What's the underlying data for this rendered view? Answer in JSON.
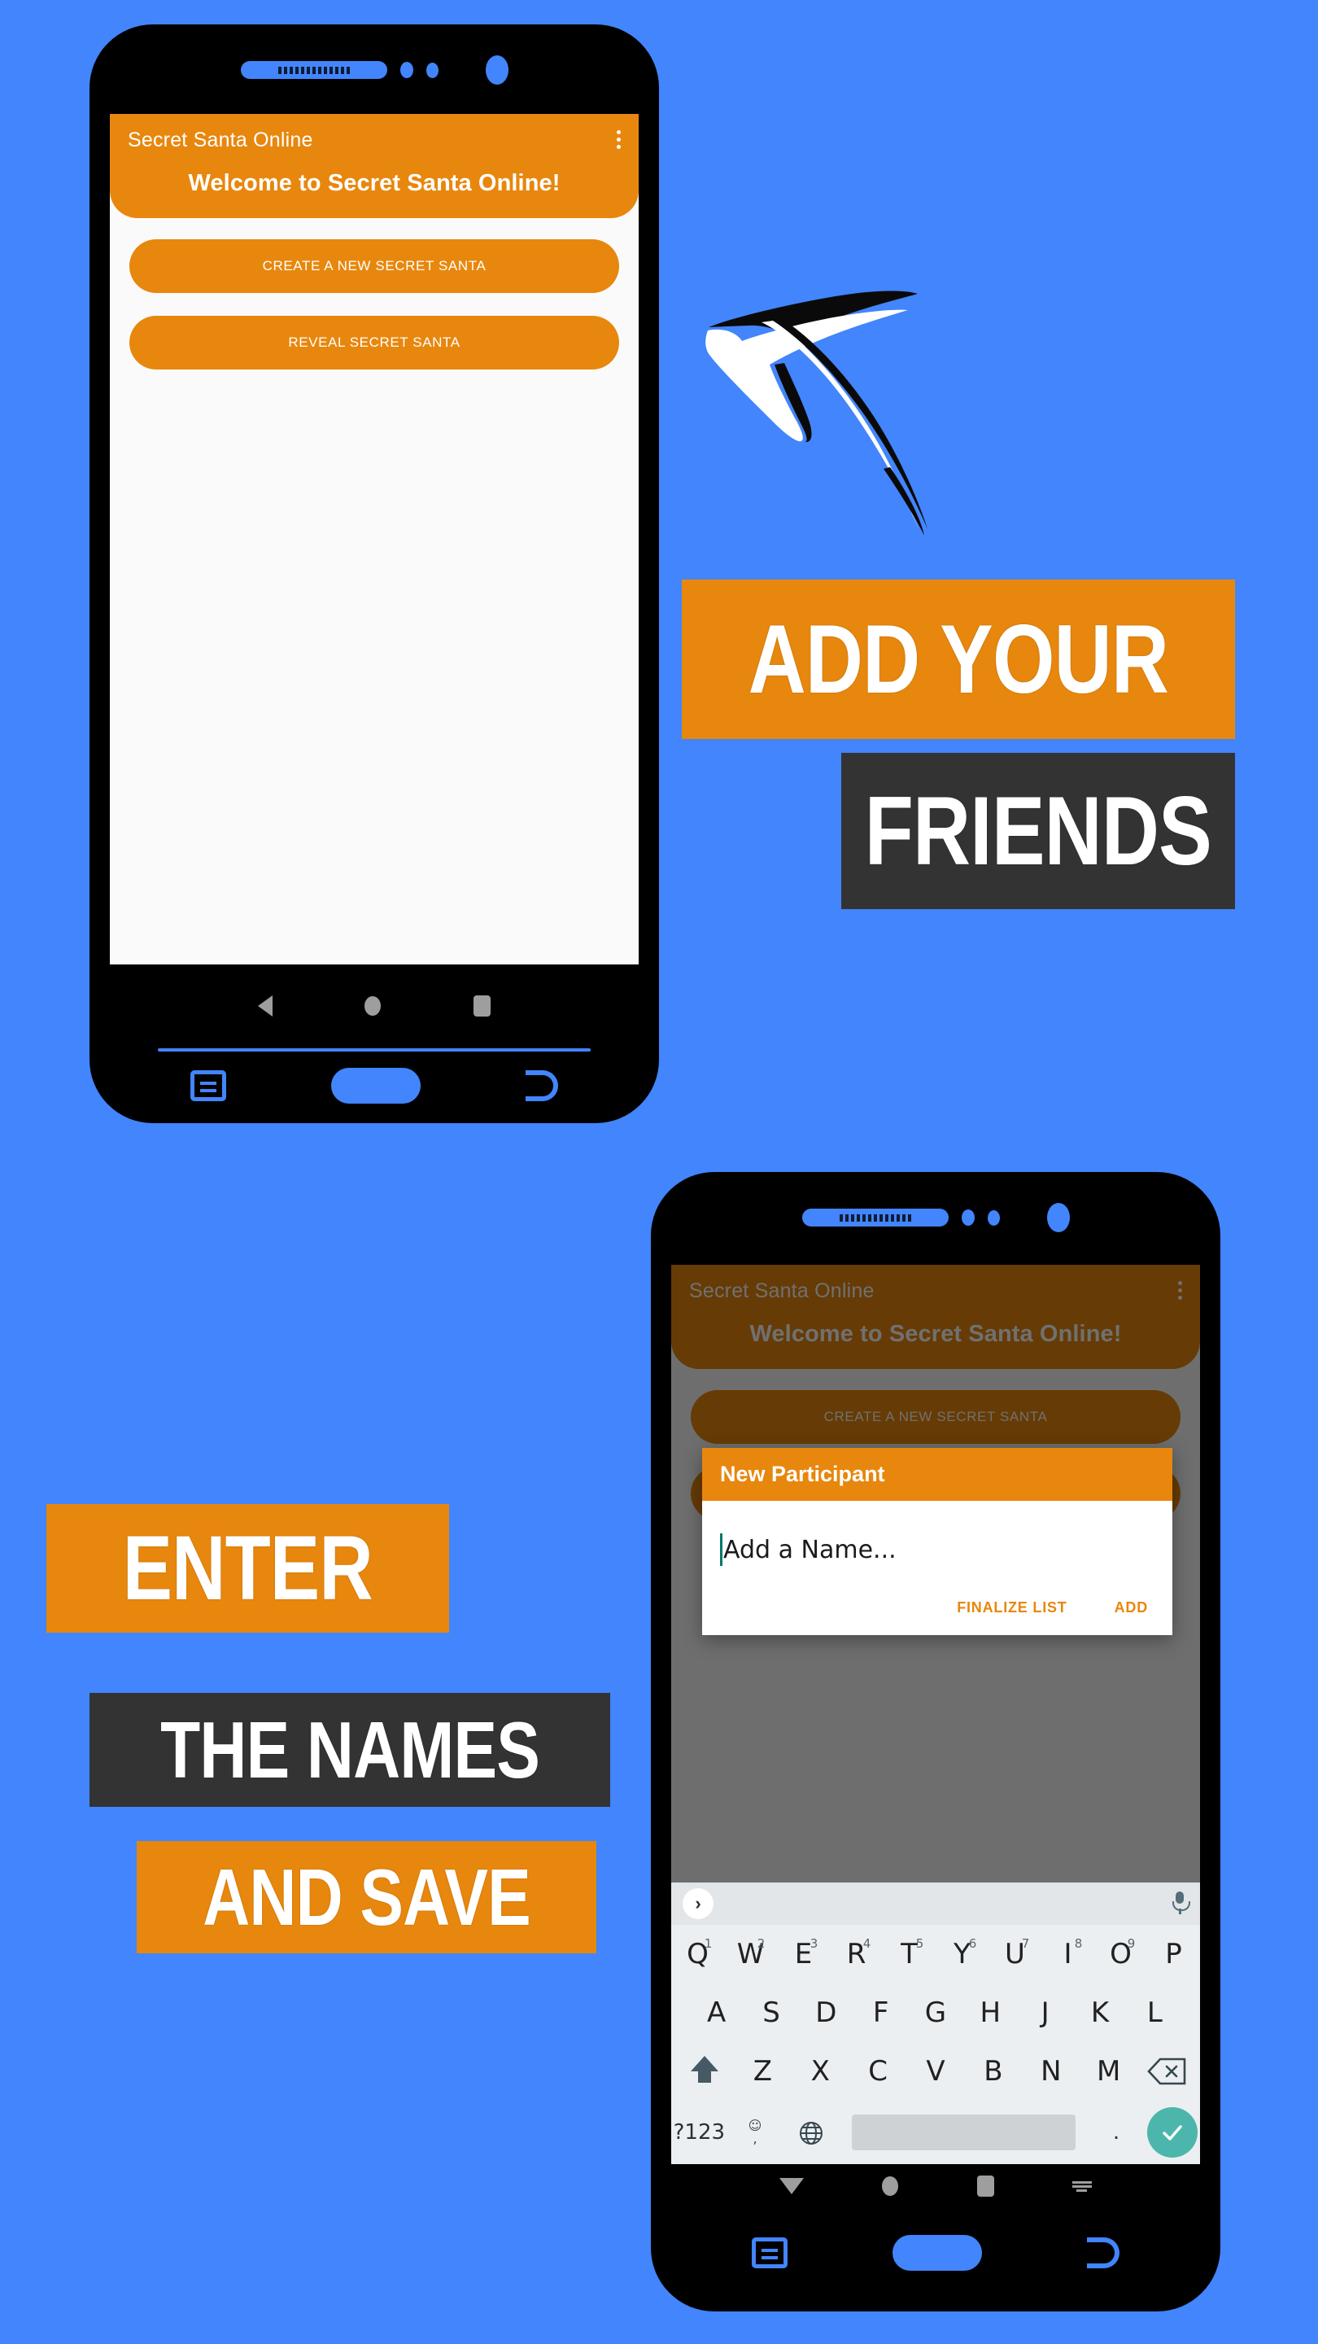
{
  "colors": {
    "background_blue": "#4285FC",
    "accent_orange": "#E8870D",
    "dark_banner": "#333333",
    "enter_key_teal": "#4DB6AC",
    "caret_teal": "#00796B"
  },
  "phone_top": {
    "app": {
      "appbar_title": "Secret Santa Online",
      "overflow_menu": "⋮",
      "welcome_heading": "Welcome to Secret Santa Online!",
      "buttons": [
        {
          "label": "CREATE A NEW SECRET SANTA"
        },
        {
          "label": "REVEAL SECRET SANTA"
        }
      ]
    },
    "navbar": {
      "back": "back-triangle",
      "home": "home-circle",
      "recents": "recents-square"
    },
    "hardware": {
      "menu": "menu-key",
      "home": "home-pill",
      "back": "back-key"
    }
  },
  "phone_bottom": {
    "app": {
      "appbar_title": "Secret Santa Online",
      "overflow_menu": "⋮",
      "welcome_heading": "Welcome to Secret Santa Online!"
    },
    "dialog": {
      "title": "New Participant",
      "input_placeholder": "Add a Name...",
      "input_value": "",
      "actions": [
        {
          "label": "FINALIZE LIST"
        },
        {
          "label": "ADD"
        }
      ]
    },
    "keyboard": {
      "suggestion_expand": "›",
      "mic": "microphone-icon",
      "row1": [
        {
          "key": "Q",
          "num": "1"
        },
        {
          "key": "W",
          "num": "2"
        },
        {
          "key": "E",
          "num": "3"
        },
        {
          "key": "R",
          "num": "4"
        },
        {
          "key": "T",
          "num": "5"
        },
        {
          "key": "Y",
          "num": "6"
        },
        {
          "key": "U",
          "num": "7"
        },
        {
          "key": "I",
          "num": "8"
        },
        {
          "key": "O",
          "num": "9"
        },
        {
          "key": "P",
          "num": ""
        }
      ],
      "row2": [
        "A",
        "S",
        "D",
        "F",
        "G",
        "H",
        "J",
        "K",
        "L"
      ],
      "row3": [
        "Z",
        "X",
        "C",
        "V",
        "B",
        "N",
        "M"
      ],
      "shift": "shift-key",
      "backspace": "backspace-key",
      "symbols": "?123",
      "emoji": "☺",
      "comma": ",",
      "language": "globe-icon",
      "space": "",
      "period": ".",
      "enter": "check-enter-key"
    },
    "navbar": {
      "hide_kbd": "down-triangle",
      "home": "home-circle",
      "recents": "recents-square",
      "kbd": "keyboard-icon"
    },
    "hardware": {
      "menu": "menu-key",
      "home": "home-pill",
      "back": "back-key"
    }
  },
  "banners": [
    {
      "id": "add",
      "text": "ADD YOUR",
      "style": "orange"
    },
    {
      "id": "friends",
      "text": "FRIENDS",
      "style": "dark"
    },
    {
      "id": "enter",
      "text": "ENTER",
      "style": "orange"
    },
    {
      "id": "names",
      "text": "THE NAMES",
      "style": "dark"
    },
    {
      "id": "save",
      "text": "AND SAVE",
      "style": "orange"
    }
  ],
  "arrow": {
    "name": "curved-arrow-up-left"
  }
}
